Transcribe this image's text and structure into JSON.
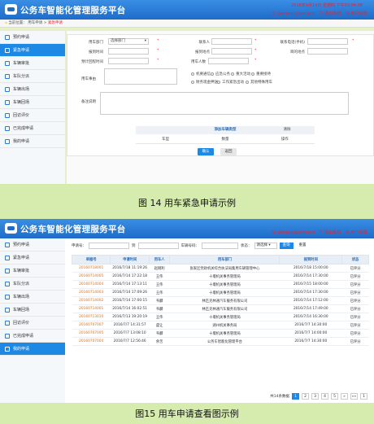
{
  "app_title": "公务车智能化管理服务平台",
  "shot1": {
    "header_top": "2016年4月14日 星期四 下午03:04:08",
    "header_user": "gwcjerp@gwcjerp",
    "header_links": [
      "退出系统",
      "用户设置"
    ],
    "breadcrumb": {
      "label": "当前位置：",
      "parent": "用车申请",
      "current": "紧急申请"
    },
    "nav": [
      "预约申请",
      "紧急申请",
      "车辆审批",
      "车队分派",
      "车辆出场",
      "车辆回场",
      "回访评价",
      "已完成申请",
      "我的申请"
    ],
    "active": 1,
    "form": {
      "dept_label": "用车部门",
      "dept_value": "选择部门",
      "contact_label": "联系人",
      "phone_label": "联系电话(手机)",
      "start_label": "报到时间",
      "place_label": "报到地点",
      "dest_label": "目的地点",
      "return_label": "预计回程时间",
      "people_label": "用车人数",
      "reason_label": "用车事由",
      "reasons": [
        "机要通信",
        "应急公务",
        "重大活动",
        "重要接待",
        "财务现金押送",
        "工作紧急出动",
        "其他特殊用车"
      ],
      "remark_label": "备注说明",
      "add_car_label": "添加车辆类型",
      "clear_label": "清除",
      "car_cols": [
        "车型",
        "数量",
        "操作"
      ],
      "submit": "确认",
      "back": "返回"
    }
  },
  "caption1": "图 14   用车紧急申请示例",
  "shot2": {
    "header_user": "gwcjerp@gwcjerp",
    "header_links": [
      "退出系统",
      "用户设置"
    ],
    "nav": [
      "预约申请",
      "紧急申请",
      "车辆审批",
      "车队分派",
      "车辆出场",
      "车辆回场",
      "回访评价",
      "已完成申请",
      "我的申请"
    ],
    "active": 8,
    "filter": {
      "no_label": "申请号：",
      "to_label": "到",
      "plate_label": "车辆号码：",
      "status_label": "状态：",
      "status_value": "请选择",
      "search": "查询",
      "reset": "重置"
    },
    "columns": [
      "单据号",
      "申请时间",
      "用车人",
      "用车部门",
      "报到时间",
      "状态"
    ],
    "rows": [
      [
        "20160718001",
        "2016/7/18 11:19:26",
        "赵刚利",
        "张家区党政机关综合执法局集用车辆管理中心",
        "2016/7/18 15:00:00",
        "已评分"
      ],
      [
        "20160714005",
        "2016/7/14 17:22:18",
        "王伟",
        "十堰机关事务管理局",
        "2016/7/14 17:30:00",
        "已评分"
      ],
      [
        "20160714004",
        "2016/7/14 17:13:11",
        "王伟",
        "十堰机关事务管理局",
        "2016/7/15 18:00:00",
        "已评分"
      ],
      [
        "20160714003",
        "2016/7/14 17:09:26",
        "王伟",
        "十堰机关事务管理局",
        "2016/7/14 17:30:00",
        "已评分"
      ],
      [
        "20160714002",
        "2016/7/14 17:00:15",
        "韦麟",
        "林匹克林通汽车服务有限公司",
        "2016/7/14 17:12:00",
        "已评分"
      ],
      [
        "20160714001",
        "2016/7/14 16:02:51",
        "韦麟",
        "林匹克林通汽车服务有限公司",
        "2016/7/14 17:49:00",
        "已评分"
      ],
      [
        "20160713010",
        "2016/7/13 19:20:19",
        "王伟",
        "十堰机关事务管理局",
        "2016/7/14 16:30:00",
        "已评分"
      ],
      [
        "20160707007",
        "2016/7/7 14:31:57",
        "虞让",
        "湖州机关事务局",
        "2016/7/7 14:30:00",
        "已评分"
      ],
      [
        "20160707005",
        "2016/7/7 13:08:10",
        "韦麟",
        "十堰机关事务管理局",
        "2016/7/7 14:00:00",
        "已评分"
      ],
      [
        "20160707004",
        "2016/7/7 12:56:46",
        "余苦",
        "公务车智能化管理平台",
        "2016/7/7 14:30:00",
        "已评分"
      ]
    ],
    "pager": {
      "total": "共14条数据",
      "pages": [
        "1",
        "2",
        "3",
        "4",
        "5"
      ],
      "next": "»",
      "last": "»»",
      "size": "1"
    }
  },
  "caption2": "图15   用车申请查看图示例",
  "colors": {
    "header": "#1e6cc9",
    "active_nav": "#1e88e5",
    "accent_red": "#e8222e",
    "orange_id": "#e0701c"
  },
  "icons": [
    "car-logo-icon",
    "user-icon",
    "power-icon",
    "settings-icon",
    "home-icon",
    "nav-item-icon"
  ]
}
